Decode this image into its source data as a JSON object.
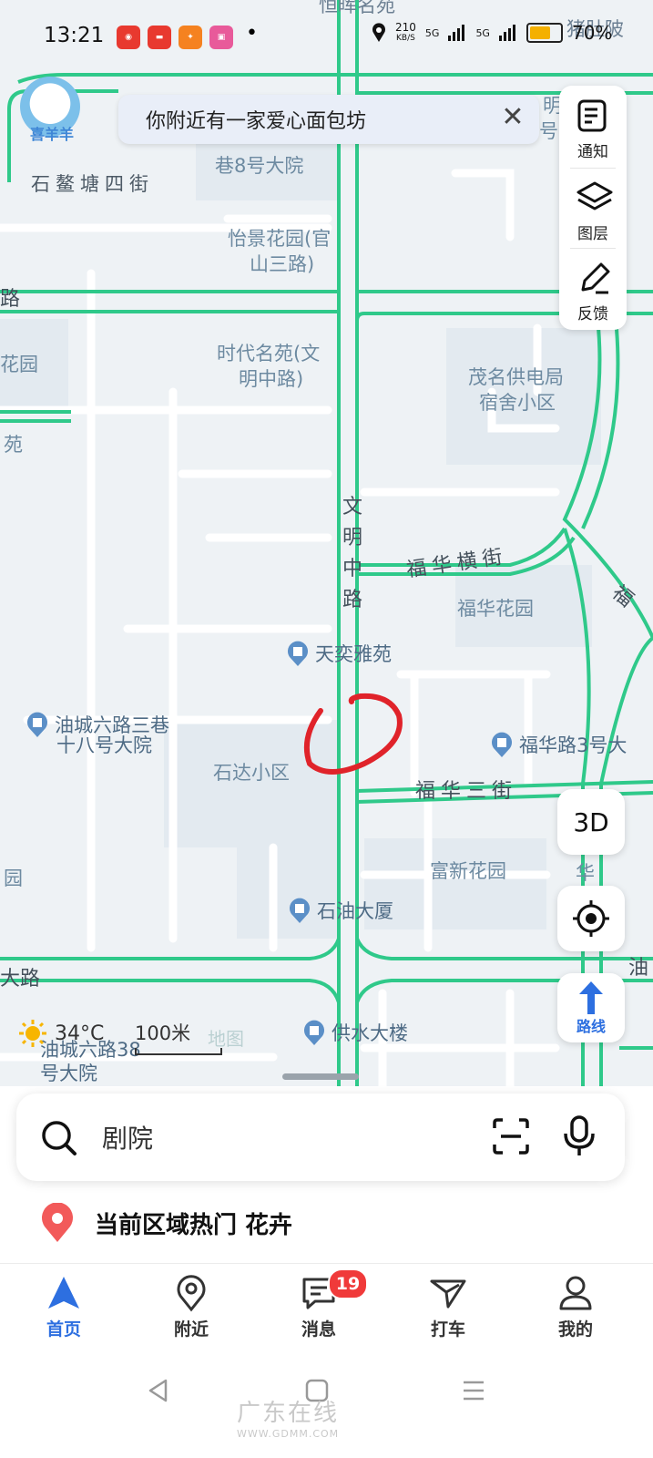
{
  "status_bar": {
    "time": "13:21",
    "speed": "210",
    "speed_unit": "KB/S",
    "net1": "5G",
    "net2": "5G",
    "battery": "70%",
    "battery_level": 0.7,
    "apps": [
      "netease-music-icon",
      "toutiao-icon",
      "app-icon",
      "bilibili-icon"
    ]
  },
  "notice": {
    "text": "你附近有一家爱心面包坊"
  },
  "avatar": {
    "name": "喜羊羊"
  },
  "toolbar": {
    "notify": "通知",
    "layers": "图层",
    "feedback": "反馈"
  },
  "map": {
    "labels": {
      "top_poi": "恒晖名苑",
      "top_right": "猪肚陂",
      "st4": "石鳌塘四街",
      "lane8": "巷8号大院",
      "yijing": "怡景花园(官",
      "yijing2": "山三路)",
      "road_left": "路",
      "huayuan": "花园",
      "shidai": "时代名苑(文",
      "shidai2": "明中路)",
      "maoming": "茂名供电局",
      "maoming2": "宿舍小区",
      "huayuan2": "苑",
      "wenming": [
        "文",
        "明",
        "中",
        "路"
      ],
      "fuhua_heng": "福华横街",
      "fuhua_garden": "福华花园",
      "fu_right": "福",
      "tianyi": "天奕雅苑",
      "youcheng": "油城六路三巷",
      "youcheng2": "十八号大院",
      "shida": "石达小区",
      "fuhua3hao": "福华路3号大",
      "fuhua3jie": "福华三街",
      "fuxin": "富新花园",
      "yuan": "园",
      "shiyou": "石油大厦",
      "dalu": "大路",
      "gongshui": "供水大楼",
      "youcheng38": "油城六路38",
      "youcheng38b": "号大院",
      "mingright": "明",
      "haoright": "号",
      "huaright": "华",
      "youright": "油"
    }
  },
  "buttons": {
    "three_d": "3D",
    "route": "路线"
  },
  "weather": {
    "temp": "34°C",
    "icon": "sun-icon"
  },
  "scale": {
    "label": "100米"
  },
  "map_logo": "地图",
  "search": {
    "placeholder": "剧院"
  },
  "hot": {
    "text": "当前区域热门 花卉"
  },
  "tabs": [
    {
      "label": "首页",
      "icon": "navigate-arrow-icon"
    },
    {
      "label": "附近",
      "icon": "location-pin-icon"
    },
    {
      "label": "消息",
      "icon": "message-icon",
      "badge": "19"
    },
    {
      "label": "打车",
      "icon": "taxi-icon"
    },
    {
      "label": "我的",
      "icon": "user-icon"
    }
  ],
  "watermark": {
    "main": "广东在线",
    "url": "WWW.GDMM.COM"
  },
  "colors": {
    "accent": "#2d6fe0",
    "road": "#2fc98a",
    "badge": "#f03a3a",
    "annotation": "#e0232a"
  }
}
